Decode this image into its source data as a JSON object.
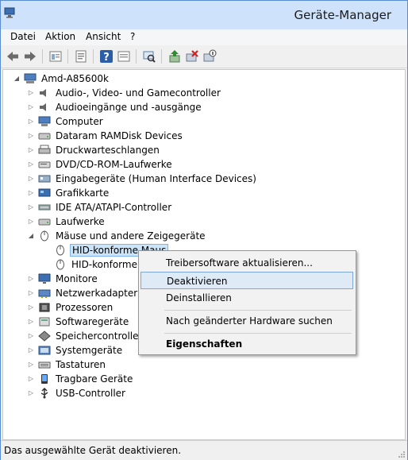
{
  "window": {
    "title": "Geräte-Manager"
  },
  "menu": [
    "Datei",
    "Aktion",
    "Ansicht",
    "?"
  ],
  "tree": {
    "root": "Amd-A85600k",
    "categories": [
      {
        "label": "Audio-, Video- und Gamecontroller",
        "icon": "speaker-icon"
      },
      {
        "label": "Audioeingänge und -ausgänge",
        "icon": "speaker-icon"
      },
      {
        "label": "Computer",
        "icon": "computer-icon"
      },
      {
        "label": "Dataram RAMDisk Devices",
        "icon": "disk-drive-icon"
      },
      {
        "label": "Druckwarteschlangen",
        "icon": "printer-icon"
      },
      {
        "label": "DVD/CD-ROM-Laufwerke",
        "icon": "dvd-drive-icon"
      },
      {
        "label": "Eingabegeräte (Human Interface Devices)",
        "icon": "hid-icon"
      },
      {
        "label": "Grafikkarte",
        "icon": "display-adapter-icon"
      },
      {
        "label": "IDE ATA/ATAPI-Controller",
        "icon": "ide-controller-icon"
      },
      {
        "label": "Laufwerke",
        "icon": "disk-drive-icon"
      },
      {
        "label": "Mäuse und andere Zeigegeräte",
        "icon": "mouse-icon",
        "expanded": true
      },
      {
        "label": "Monitore",
        "icon": "monitor-icon"
      },
      {
        "label": "Netzwerkadapter",
        "icon": "network-adapter-icon"
      },
      {
        "label": "Prozessoren",
        "icon": "processor-icon"
      },
      {
        "label": "Softwaregeräte",
        "icon": "software-device-icon"
      },
      {
        "label": "Speichercontroller",
        "icon": "storage-controller-icon"
      },
      {
        "label": "Systemgeräte",
        "icon": "system-device-icon"
      },
      {
        "label": "Tastaturen",
        "icon": "keyboard-icon"
      },
      {
        "label": "Tragbare Geräte",
        "icon": "portable-device-icon"
      },
      {
        "label": "USB-Controller",
        "icon": "usb-icon"
      }
    ],
    "mouse_children": [
      "HID-konforme Maus",
      "HID-konforme M"
    ]
  },
  "context_menu": {
    "items": [
      "Treibersoftware aktualisieren...",
      "Deaktivieren",
      "Deinstallieren",
      "Nach geänderter Hardware suchen",
      "Eigenschaften"
    ],
    "highlighted": "Deaktivieren"
  },
  "status": "Das ausgewählte Gerät deaktivieren.",
  "colors": {
    "titlebar": "#cfe2fb",
    "selection": "#cce4f7",
    "highlight_border": "#7da7d8"
  }
}
